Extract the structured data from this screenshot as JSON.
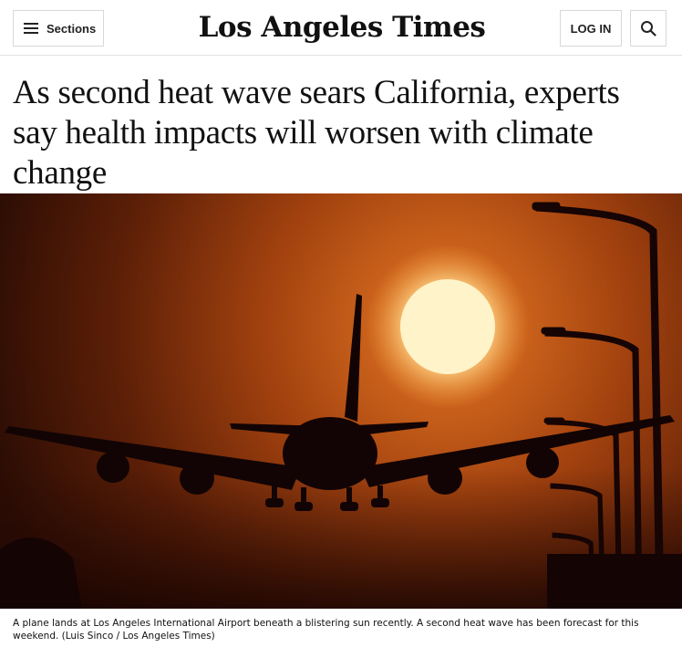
{
  "header": {
    "sections_label": "Sections",
    "logo_text": "Los Angeles Times",
    "login_label": "LOG IN"
  },
  "article": {
    "headline": "As second heat wave sears California, experts say health impacts will worsen with climate change",
    "caption": "A plane lands at Los Angeles International Airport beneath a blistering sun recently. A second heat wave has been forecast for this weekend. (Luis Sinco / Los Angeles Times)"
  },
  "icons": {
    "menu": "hamburger-icon",
    "search": "search-icon"
  },
  "colors": {
    "sky_top": "#2a0c04",
    "sky_glow": "#c2581a",
    "sun": "#fff1c4",
    "silhouette": "#120404"
  }
}
